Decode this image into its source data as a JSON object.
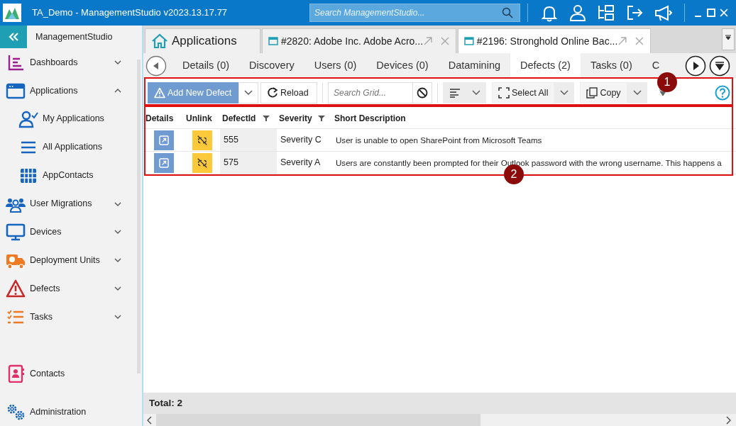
{
  "window": {
    "title": "TA_Demo - ManagementStudio v2023.13.17.77",
    "search": {
      "placeholder": "Search ManagementStudio..."
    }
  },
  "sidebar": {
    "header": "ManagementStudio",
    "items": [
      {
        "label": "Dashboards",
        "expanded": false
      },
      {
        "label": "Applications",
        "expanded": true,
        "children": [
          {
            "label": "My Applications"
          },
          {
            "label": "All Applications"
          },
          {
            "label": "AppContacts"
          }
        ]
      },
      {
        "label": "User Migrations",
        "expanded": false
      },
      {
        "label": "Devices",
        "expanded": false
      },
      {
        "label": "Deployment Units",
        "expanded": false
      },
      {
        "label": "Defects",
        "expanded": false
      },
      {
        "label": "Tasks",
        "expanded": false
      }
    ],
    "footer_items": [
      {
        "label": "Contacts"
      },
      {
        "label": "Administration"
      }
    ]
  },
  "document_tabs": [
    {
      "kind": "home",
      "label": "Applications",
      "selected": false
    },
    {
      "kind": "record",
      "label": "#2820: Adobe Inc. Adobe Acro...",
      "selected": false
    },
    {
      "kind": "record",
      "label": "#2196: Stronghold Online Bac...",
      "selected": true
    }
  ],
  "section_tabs": [
    {
      "label": "Details (0)",
      "selected": false
    },
    {
      "label": "Discovery",
      "selected": false
    },
    {
      "label": "Users (0)",
      "selected": false
    },
    {
      "label": "Devices (0)",
      "selected": false
    },
    {
      "label": "Datamining",
      "selected": false
    },
    {
      "label": "Defects (2)",
      "selected": true
    },
    {
      "label": "Tasks (0)",
      "selected": false
    },
    {
      "label": "C",
      "selected": false
    }
  ],
  "toolbar": {
    "add_button": "Add New Defect",
    "reload_button": "Reload",
    "search": {
      "placeholder": "Search Grid..."
    },
    "select_all_button": "Select All",
    "copy_button": "Copy"
  },
  "grid": {
    "columns": [
      {
        "label": "Details",
        "filter": false
      },
      {
        "label": "Unlink",
        "filter": false
      },
      {
        "label": "DefectId",
        "filter": true
      },
      {
        "label": "Severity",
        "filter": true
      },
      {
        "label": "Short Description",
        "filter": false
      }
    ],
    "rows": [
      {
        "defect_id": "555",
        "severity": "Severity C",
        "short_description": "User is unable to open SharePoint from Microsoft Teams"
      },
      {
        "defect_id": "575",
        "severity": "Severity A",
        "short_description": "Users are constantly been prompted for their Outlook password with the wrong username. This happens a"
      }
    ]
  },
  "footer": {
    "total": "Total: 2"
  },
  "annotations": [
    {
      "label": "1"
    },
    {
      "label": "2"
    }
  ]
}
